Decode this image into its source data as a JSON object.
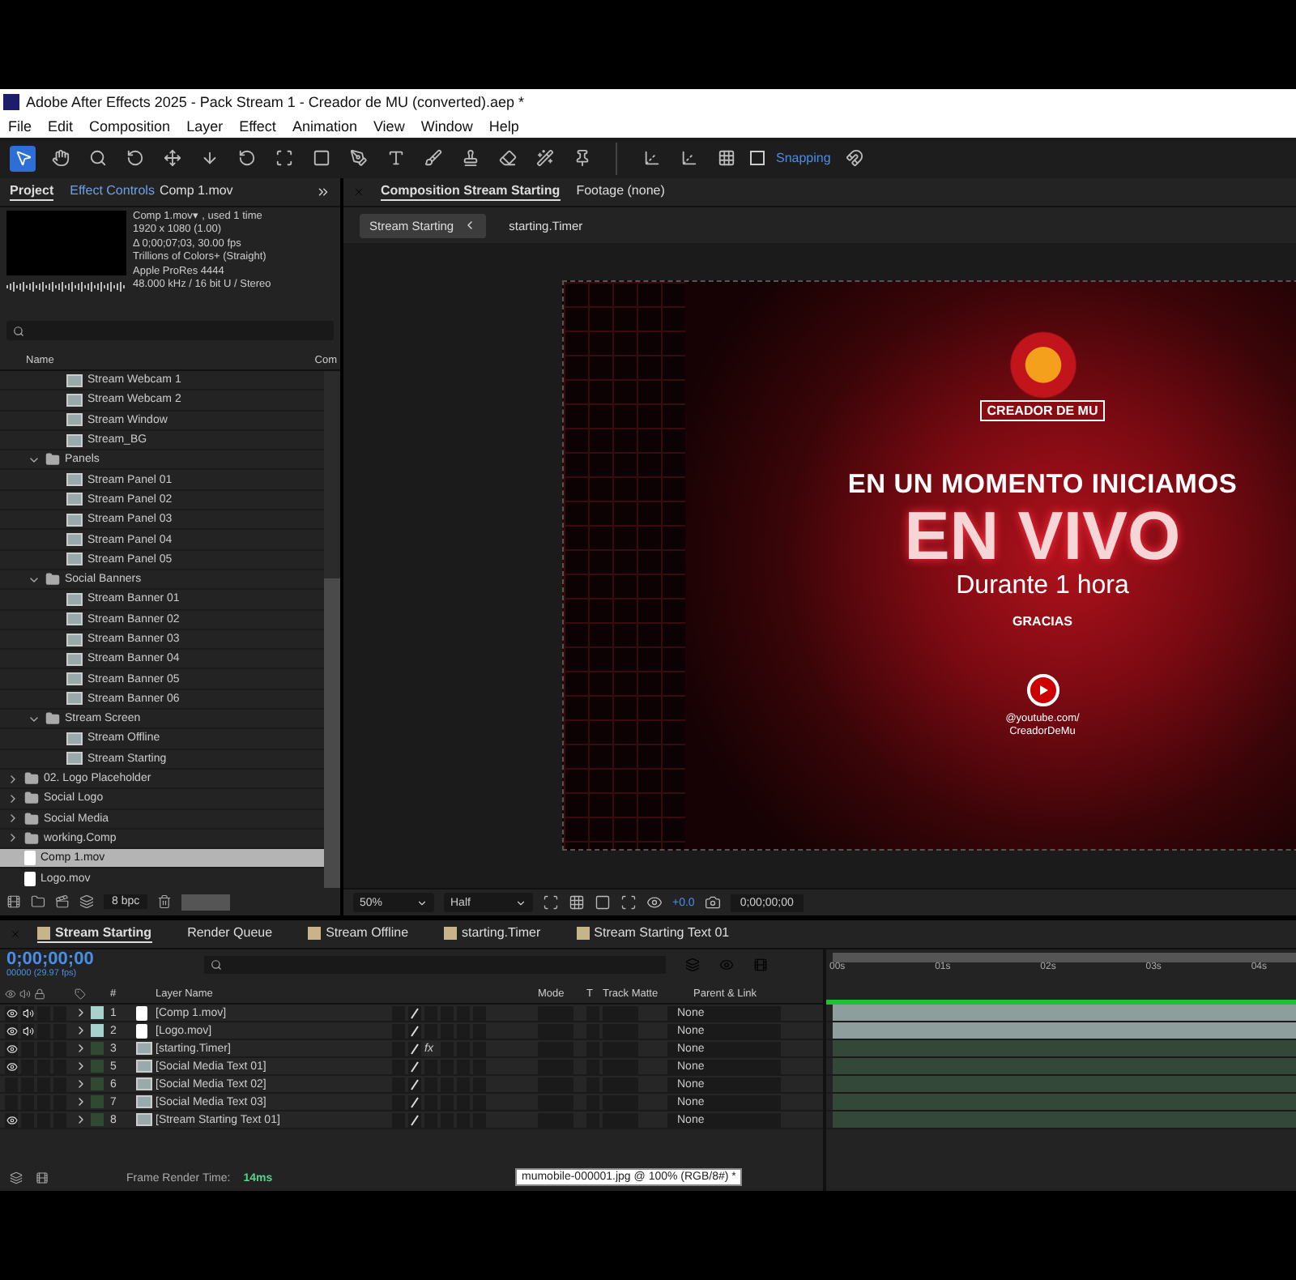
{
  "window": {
    "title": "Adobe After Effects 2025 - Pack Stream 1 - Creador de MU (converted).aep *"
  },
  "menu": [
    "File",
    "Edit",
    "Composition",
    "Layer",
    "Effect",
    "Animation",
    "View",
    "Window",
    "Help"
  ],
  "toolbar": {
    "snapping": {
      "label": "Snapping",
      "checked": false
    }
  },
  "project": {
    "tabs": [
      {
        "label": "Project",
        "selected": true
      },
      {
        "label": "Effect Controls",
        "target": "Comp 1.mov",
        "selected": false
      }
    ],
    "info": [
      "Comp 1.mov▾ , used 1 time",
      "1920 x 1080 (1.00)",
      "Δ 0;00;07;03, 30.00 fps",
      "Trillions of Colors+ (Straight)",
      "Apple ProRes 4444",
      "48.000 kHz / 16 bit U / Stereo"
    ],
    "columns": [
      "Name",
      "Com"
    ],
    "items": [
      {
        "kind": "offscreen",
        "children": [
          {
            "kind": "offscreen",
            "children": [
              {
                "label": "Stream Webcam 1",
                "kind": "comp",
                "selected": false
              },
              {
                "label": "Stream Webcam 2",
                "kind": "comp",
                "selected": false
              },
              {
                "label": "Stream Window",
                "kind": "comp",
                "selected": false
              },
              {
                "label": "Stream_BG",
                "kind": "comp",
                "selected": false
              }
            ]
          },
          {
            "label": "Panels",
            "kind": "folder",
            "expanded": true,
            "selected": false,
            "children": [
              {
                "label": "Stream Panel 01",
                "kind": "comp",
                "selected": false
              },
              {
                "label": "Stream Panel 02",
                "kind": "comp",
                "selected": false
              },
              {
                "label": "Stream Panel 03",
                "kind": "comp",
                "selected": false
              },
              {
                "label": "Stream Panel 04",
                "kind": "comp",
                "selected": false
              },
              {
                "label": "Stream Panel 05",
                "kind": "comp",
                "selected": false
              }
            ]
          },
          {
            "label": "Social Banners",
            "kind": "folder",
            "expanded": true,
            "selected": false,
            "children": [
              {
                "label": "Stream Banner 01",
                "kind": "comp",
                "selected": false
              },
              {
                "label": "Stream Banner 02",
                "kind": "comp",
                "selected": false
              },
              {
                "label": "Stream Banner 03",
                "kind": "comp",
                "selected": false
              },
              {
                "label": "Stream Banner 04",
                "kind": "comp",
                "selected": false
              },
              {
                "label": "Stream Banner 05",
                "kind": "comp",
                "selected": false
              },
              {
                "label": "Stream Banner 06",
                "kind": "comp",
                "selected": false
              }
            ]
          },
          {
            "label": "Stream Screen",
            "kind": "folder",
            "expanded": true,
            "selected": false,
            "children": [
              {
                "label": "Stream Offline",
                "kind": "comp",
                "selected": false
              },
              {
                "label": "Stream Starting",
                "kind": "comp",
                "selected": false
              }
            ]
          }
        ]
      },
      {
        "label": "02. Logo Placeholder",
        "kind": "folder",
        "expanded": false,
        "selected": false
      },
      {
        "label": "Social Logo",
        "kind": "folder",
        "expanded": false,
        "selected": false
      },
      {
        "label": "Social Media",
        "kind": "folder",
        "expanded": false,
        "selected": false
      },
      {
        "label": "working.Comp",
        "kind": "folder",
        "expanded": false,
        "selected": false
      },
      {
        "label": "Comp 1.mov",
        "kind": "footage",
        "selected": true
      },
      {
        "label": "Logo.mov",
        "kind": "footage",
        "selected": false
      }
    ],
    "bpc": "8 bpc"
  },
  "viewer": {
    "tabs": [
      {
        "label": "Composition Stream Starting",
        "selected": true
      },
      {
        "label": "Footage (none)",
        "selected": false
      }
    ],
    "breadcrumbs": [
      {
        "label": "Stream Starting",
        "selected": true
      },
      {
        "label": "starting.Timer",
        "selected": false
      }
    ],
    "artwork": {
      "logo": "CREADOR DE MU",
      "headline": "EN UN MOMENTO INICIAMOS",
      "title": "EN VIVO",
      "subtitle": "Durante 1 hora",
      "note": "GRACIAS",
      "link": [
        "@youtube.com/",
        "CreadorDeMu"
      ]
    },
    "zoom": "50%",
    "resolution": "Half",
    "exposure": "+0.0",
    "timecode": "0;00;00;00"
  },
  "timeline": {
    "tabs": [
      {
        "label": "Stream Starting",
        "kind": "comp",
        "selected": true
      },
      {
        "label": "Render Queue",
        "kind": "queue",
        "selected": false
      },
      {
        "label": "Stream Offline",
        "kind": "comp",
        "selected": false
      },
      {
        "label": "starting.Timer",
        "kind": "comp",
        "selected": false
      },
      {
        "label": "Stream Starting Text 01",
        "kind": "comp",
        "selected": false
      }
    ],
    "timecode": "0;00;00;00",
    "fps": "00000 (29.97 fps)",
    "columns": {
      "number": "#",
      "name": "Layer Name",
      "mode": "Mode",
      "t": "T",
      "matte": "Track Matte",
      "parent": "Parent & Link"
    },
    "ruler": [
      "00s",
      "01s",
      "02s",
      "03s",
      "04s"
    ],
    "layers": [
      {
        "number": "1",
        "name": "[Comp 1.mov]",
        "kind": "footage",
        "visible": true,
        "audio": true,
        "color": "#a7d1cd",
        "parent": "None"
      },
      {
        "number": "2",
        "name": "[Logo.mov]",
        "kind": "footage",
        "visible": true,
        "audio": true,
        "color": "#a7d1cd",
        "parent": "None"
      },
      {
        "number": "3",
        "name": "[starting.Timer]",
        "kind": "comp",
        "visible": true,
        "audio": false,
        "color": "#2f4a30",
        "fx": "fx",
        "parent": "None"
      },
      {
        "number": "5",
        "name": "[Social Media Text 01]",
        "kind": "comp",
        "visible": true,
        "audio": false,
        "color": "#2f4a30",
        "parent": "None"
      },
      {
        "number": "6",
        "name": "[Social Media Text 02]",
        "kind": "comp",
        "visible": false,
        "audio": false,
        "color": "#2f4a30",
        "parent": "None"
      },
      {
        "number": "7",
        "name": "[Social Media Text 03]",
        "kind": "comp",
        "visible": false,
        "audio": false,
        "color": "#2f4a30",
        "parent": "None"
      },
      {
        "number": "8",
        "name": "[Stream Starting Text 01]",
        "kind": "comp",
        "visible": true,
        "audio": false,
        "color": "#2f4a30",
        "parent": "None"
      }
    ],
    "render_time_label": "Frame Render Time:",
    "render_time": "14ms"
  },
  "tooltip": "mumobile-000001.jpg @ 100% (RGB/8#) *"
}
